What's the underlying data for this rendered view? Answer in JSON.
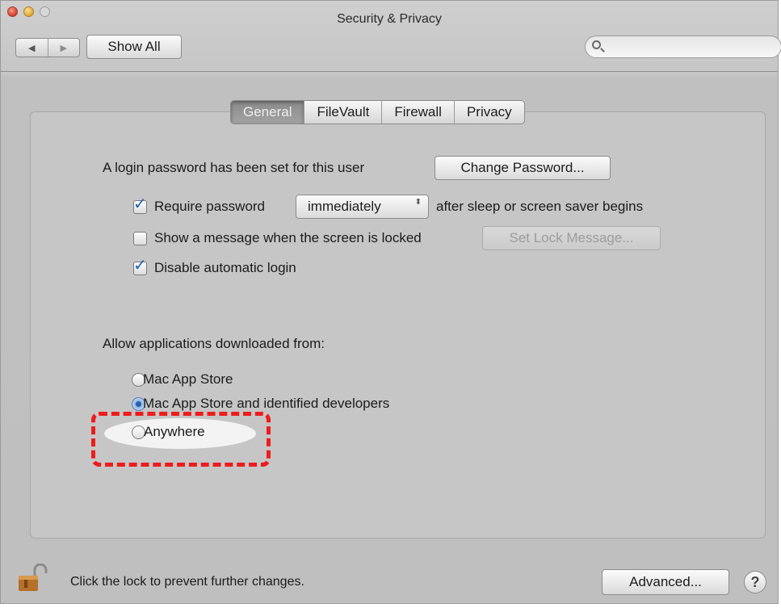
{
  "window": {
    "title": "Security & Privacy"
  },
  "toolbar": {
    "back_glyph": "◀",
    "forward_glyph": "▶",
    "show_all_label": "Show All",
    "search_value": "",
    "search_placeholder": ""
  },
  "tabs": [
    {
      "label": "General",
      "selected": true
    },
    {
      "label": "FileVault",
      "selected": false
    },
    {
      "label": "Firewall",
      "selected": false
    },
    {
      "label": "Privacy",
      "selected": false
    }
  ],
  "general": {
    "login_text": "A login password has been set for this user",
    "change_password_label": "Change Password...",
    "require_password": {
      "label": "Require password",
      "checked": true
    },
    "require_timing": {
      "selected": "immediately",
      "arrows": "⬍"
    },
    "after_text": "after sleep or screen saver begins",
    "show_message": {
      "label": "Show a message when the screen is locked",
      "checked": false
    },
    "set_lock_message_label": "Set Lock Message...",
    "disable_auto_login": {
      "label": "Disable automatic login",
      "checked": true
    },
    "allow_apps_heading": "Allow applications downloaded from:",
    "radio_options": [
      {
        "label": "Mac App Store",
        "selected": false
      },
      {
        "label": "Mac App Store and identified developers",
        "selected": true
      },
      {
        "label": "Anywhere",
        "selected": false
      }
    ]
  },
  "footer": {
    "lock_text": "Click the lock to prevent further changes.",
    "advanced_label": "Advanced...",
    "help_label": "?"
  },
  "icons": {
    "close": "close-icon",
    "minimize": "minimize-icon",
    "zoom": "zoom-icon",
    "search": "search-icon",
    "lock": "lock-icon",
    "help": "help-icon"
  },
  "colors": {
    "annotation": "#ee1c1c",
    "check_accent": "#1f63b8",
    "selected_radio": "#2a5fa8"
  }
}
